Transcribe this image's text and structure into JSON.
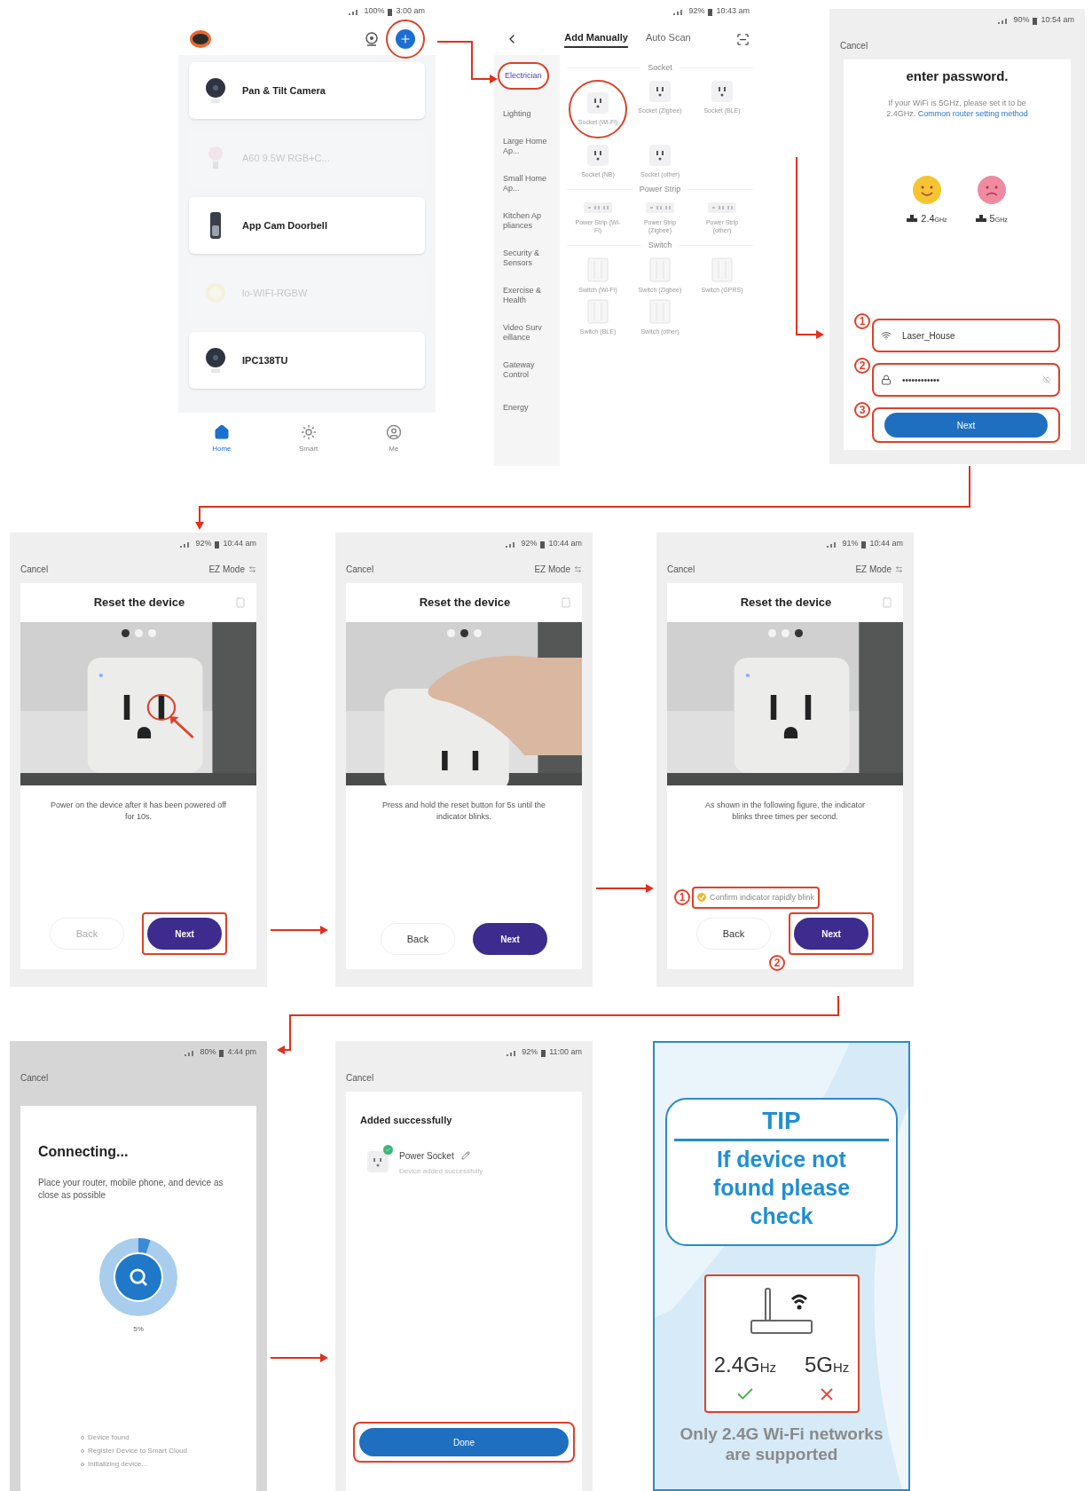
{
  "home_screen": {
    "status": {
      "battery": "100%",
      "time": "3:00 am"
    },
    "devices": [
      {
        "name": "Pan & Tilt Camera",
        "kind": "camera",
        "online": true
      },
      {
        "name": "A60 9.5W RGB+C...",
        "kind": "bulb",
        "online": false
      },
      {
        "name": "App Cam Doorbell",
        "kind": "doorbell",
        "online": true
      },
      {
        "name": "lo-WIFI-RGBW",
        "kind": "lamp",
        "online": false
      },
      {
        "name": "IPC138TU",
        "kind": "camera",
        "online": true
      }
    ],
    "tabs": [
      {
        "label": "Home",
        "kind": "home",
        "selected": true
      },
      {
        "label": "Smart",
        "kind": "sun",
        "selected": false
      },
      {
        "label": "Me",
        "kind": "user",
        "selected": false
      }
    ]
  },
  "add_device_screen": {
    "status": {
      "battery": "92%",
      "time": "10:43 am"
    },
    "tabs": [
      {
        "label": "Add Manually",
        "selected": true
      },
      {
        "label": "Auto Scan",
        "selected": false
      }
    ],
    "categories": [
      {
        "label": "Electrician",
        "selected": true
      },
      {
        "label": "Lighting",
        "selected": false
      },
      {
        "label": "Large Home Ap...",
        "selected": false
      },
      {
        "label": "Small Home Ap...",
        "selected": false
      },
      {
        "label": "Kitchen Ap pliances",
        "selected": false
      },
      {
        "label": "Security & Sensors",
        "selected": false
      },
      {
        "label": "Exercise & Health",
        "selected": false
      },
      {
        "label": "Video Surv eillance",
        "selected": false
      },
      {
        "label": "Gateway Control",
        "selected": false
      },
      {
        "label": "Energy",
        "selected": false
      }
    ],
    "sections": [
      {
        "title": "Socket",
        "kind": "socket",
        "items": [
          "Socket (Wi-Fi)",
          "Socket (Zigbee)",
          "Socket (BLE)",
          "Socket (NB)",
          "Socket (other)"
        ]
      },
      {
        "title": "Power Strip",
        "kind": "strip",
        "items": [
          "Power Strip (Wi-Fi)",
          "Power Strip (Zigbee)",
          "Power Strip (other)"
        ]
      },
      {
        "title": "Switch",
        "kind": "switch",
        "items": [
          "Switch (Wi-Fi)",
          "Switch (Zigbee)",
          "Switch (GPRS)",
          "Switch (BLE)",
          "Switch (other)"
        ]
      }
    ]
  },
  "wifi_screen": {
    "status": {
      "battery": "90%",
      "time": "10:54 am"
    },
    "cancel": "Cancel",
    "heading": "enter password.",
    "note": "If your WiFi is 5GHz, please set it to be 2.4GHz.",
    "link": "Common router setting method",
    "bands": [
      {
        "value": "2.4",
        "unit": "GHz",
        "ok": true
      },
      {
        "value": "5",
        "unit": "GHz",
        "ok": false
      }
    ],
    "ssid": "Laser_House",
    "password": "••••••••••••",
    "button": "Next",
    "callouts": [
      "1",
      "2",
      "3"
    ]
  },
  "reset_screens": [
    {
      "status": {
        "battery": "92%",
        "time": "10:44 am"
      },
      "cancel": "Cancel",
      "mode": "EZ Mode",
      "title": "Reset the device",
      "pages": [
        {
          "selected": true
        },
        {
          "selected": false
        },
        {
          "selected": false
        }
      ],
      "caption": "Power on the device after it has been powered off for 10s.",
      "back": {
        "label": "Back",
        "disabled": true
      },
      "next": "Next",
      "next_highlighted": true
    },
    {
      "status": {
        "battery": "92%",
        "time": "10:44 am"
      },
      "cancel": "Cancel",
      "mode": "EZ Mode",
      "title": "Reset the device",
      "pages": [
        {
          "selected": false
        },
        {
          "selected": true
        },
        {
          "selected": false
        }
      ],
      "caption": "Press and hold the reset button for 5s until the indicator blinks.",
      "back": {
        "label": "Back",
        "disabled": false
      },
      "next": "Next",
      "next_highlighted": false
    },
    {
      "status": {
        "battery": "91%",
        "time": "10:44 am"
      },
      "cancel": "Cancel",
      "mode": "EZ Mode",
      "title": "Reset the device",
      "pages": [
        {
          "selected": false
        },
        {
          "selected": false
        },
        {
          "selected": true
        }
      ],
      "caption": "As shown in the following figure, the indicator blinks three times per second.",
      "confirm": {
        "label": "Confirm indicator rapidly blink",
        "checked": true
      },
      "back": {
        "label": "Back",
        "disabled": false
      },
      "next": "Next",
      "next_highlighted": true,
      "callouts": [
        "1",
        "2"
      ]
    }
  ],
  "connecting_screen": {
    "status": {
      "battery": "80%",
      "time": "4:44 pm"
    },
    "cancel": "Cancel",
    "title": "Connecting...",
    "text": "Place your router, mobile phone, and device as close as possible",
    "level": 0.05,
    "percent": "5%",
    "steps": [
      "Device found",
      "Register Device to Smart Cloud",
      "Initializing device..."
    ]
  },
  "success_screen": {
    "status": {
      "battery": "92%",
      "time": "11:00 am"
    },
    "cancel": "Cancel",
    "title": "Added successfully",
    "device": "Power Socket",
    "device_status": "Device added successfully",
    "button": "Done"
  },
  "tip": {
    "title": "TIP",
    "text": "If device not found please check",
    "bands": [
      {
        "value": "2.4G",
        "unit": "Hz",
        "supported": true
      },
      {
        "value": "5G",
        "unit": "Hz",
        "supported": false
      }
    ],
    "footer": "Only 2.4G Wi-Fi networks are supported"
  }
}
